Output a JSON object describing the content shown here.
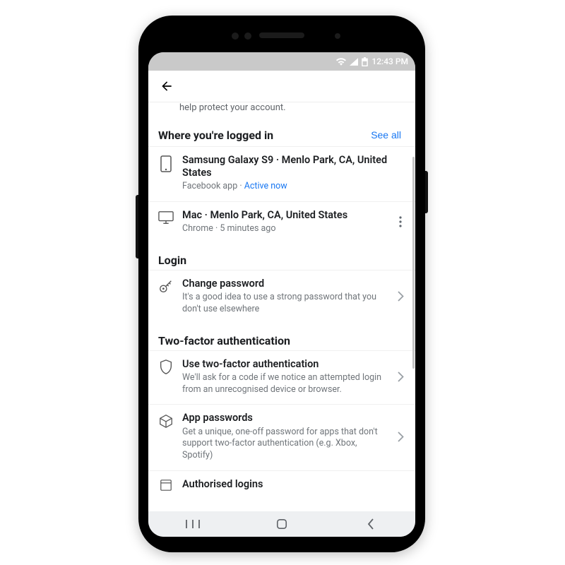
{
  "status": {
    "time": "12:43 PM"
  },
  "intro_fragment": "help protect your account.",
  "sections": {
    "logged_in": {
      "heading": "Where you're logged in",
      "see_all": "See all",
      "sessions": [
        {
          "title": "Samsung Galaxy S9 · Menlo Park, CA, United States",
          "app": "Facebook app",
          "sep": " · ",
          "status": "Active now"
        },
        {
          "title": "Mac · Menlo Park, CA, United States",
          "meta": "Chrome · 5 minutes ago"
        }
      ]
    },
    "login": {
      "heading": "Login",
      "items": [
        {
          "title": "Change password",
          "sub": "It's a good idea to use a strong password that you don't use elsewhere"
        }
      ]
    },
    "tfa": {
      "heading": "Two-factor authentication",
      "items": [
        {
          "title": "Use two-factor authentication",
          "sub": "We'll ask for a code if we notice an attempted login from an unrecognised device or browser."
        },
        {
          "title": "App passwords",
          "sub": "Get a unique, one-off password for apps that don't support two-factor authentication (e.g. Xbox, Spotify)"
        },
        {
          "title": "Authorised logins",
          "sub": ""
        }
      ]
    }
  }
}
